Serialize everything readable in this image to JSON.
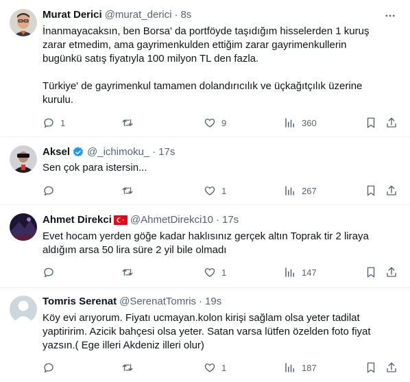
{
  "tweets": [
    {
      "name": "Murat Derici",
      "handle": "@murat_derici",
      "time": "8s",
      "text": "İnanmayacaksın, ben Borsa' da portföyde taşıdığım hisselerden 1 kuruş\nzarar etmedim, ama gayrimenkulden ettiğim zarar gayrimenkullerin\nbugünkü satış fiyatıyla 100 milyon TL den fazla.\n\nTürkiye' de gayrimenkul tamamen dolandırıcılık ve üçkağıtçılık üzerine\nkurulu.",
      "replies": "1",
      "retweets": "",
      "likes": "9",
      "views": "360"
    },
    {
      "name": "Aksel",
      "handle": "@_ichimoku_",
      "time": "17s",
      "verified": true,
      "text": "Sen çok para istersin...",
      "replies": "",
      "retweets": "",
      "likes": "1",
      "views": "267"
    },
    {
      "name": "Ahmet Direkci",
      "handle": "@AhmetDirekci10",
      "time": "17s",
      "flag": "turkey-flag-icon",
      "text": "Evet hocam yerden göğe kadar haklısınız gerçek altın Toprak tir 2 liraya\naldığım arsa 50 lira süre 2 yil bile olmadı",
      "replies": "",
      "retweets": "",
      "likes": "1",
      "views": "147"
    },
    {
      "name": "Tomris Serenat",
      "handle": "@SerenatTomris",
      "time": "19s",
      "text": "Köy evi arıyorum. Fiyatı ucmayan.kolon kirişi sağlam olsa yeter tadilat\nyaptiririm. Azicik bahçesi olsa yeter. Satan varsa lütfen özelden foto fiyat\nyazsın.( Ege illeri Akdeniz illeri olur)",
      "replies": "",
      "retweets": "",
      "likes": "1",
      "views": "187"
    }
  ],
  "icons": [
    "reply-icon",
    "retweet-icon",
    "like-icon",
    "views-icon",
    "bookmark-icon",
    "share-icon",
    "more-icon",
    "verified-badge-icon"
  ],
  "colors": {
    "text": "#0f1419",
    "secondary": "#536471",
    "verified": "#1d9bf0",
    "divider": "#eff3f4"
  }
}
